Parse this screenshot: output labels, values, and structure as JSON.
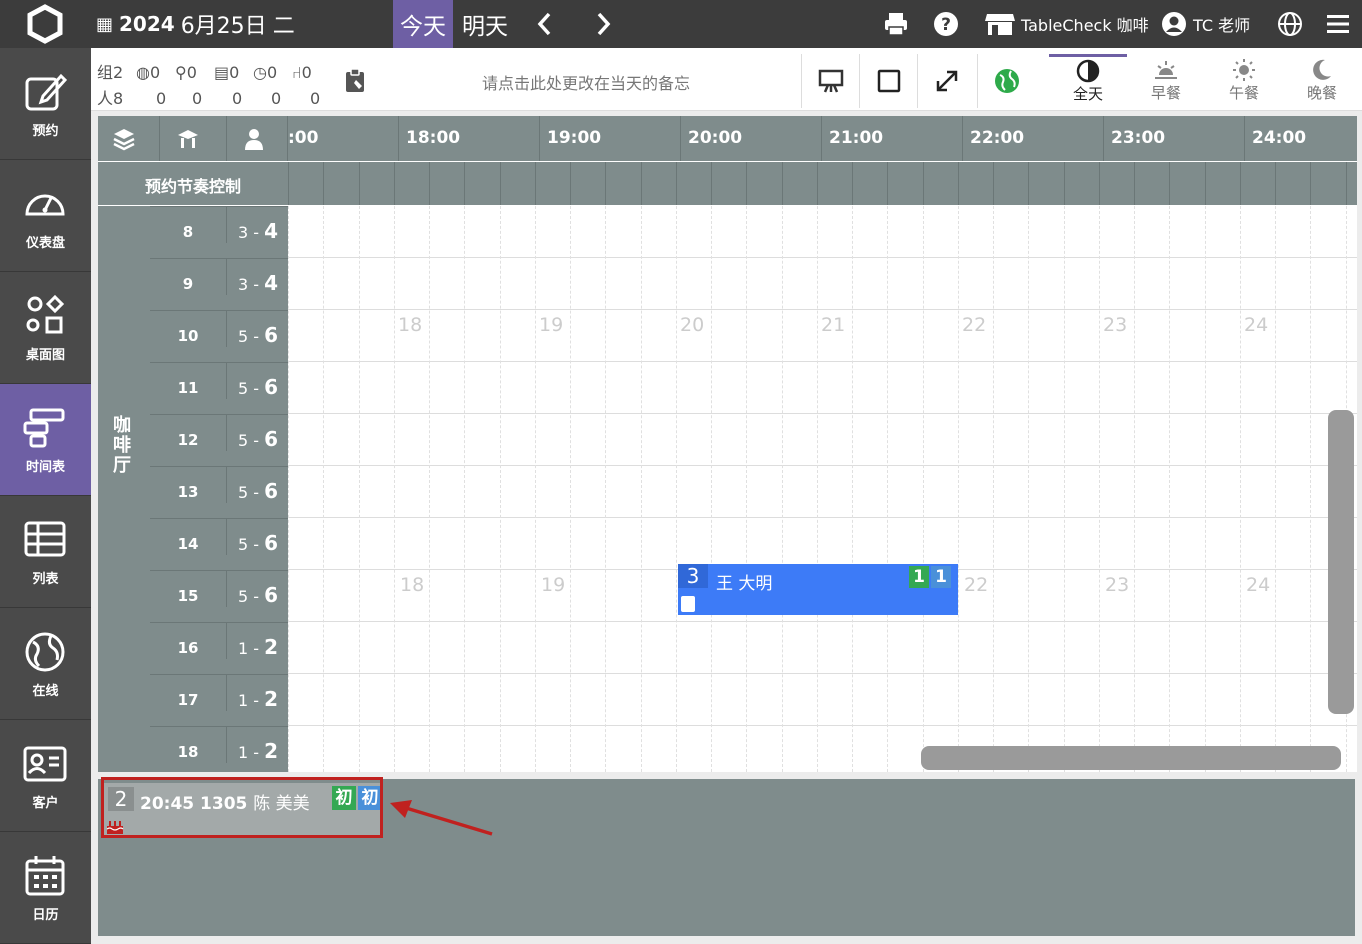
{
  "header": {
    "year": "2024",
    "date": "6月25日",
    "weekday": "二",
    "today": "今天",
    "tomorrow": "明天",
    "shop": "TableCheck 咖啡",
    "user": "TC 老师"
  },
  "sidebar": [
    {
      "label": "预约",
      "icon": "edit-icon"
    },
    {
      "label": "仪表盘",
      "icon": "gauge-icon"
    },
    {
      "label": "桌面图",
      "icon": "shapes-icon"
    },
    {
      "label": "时间表",
      "icon": "timeline-icon",
      "active": true
    },
    {
      "label": "列表",
      "icon": "table-icon"
    },
    {
      "label": "在线",
      "icon": "globe-icon"
    },
    {
      "label": "客户",
      "icon": "id-card-icon"
    },
    {
      "label": "日历",
      "icon": "calendar-icon"
    }
  ],
  "counts": {
    "row1": [
      "组2",
      "0",
      "0",
      "0",
      "0",
      "0"
    ],
    "row2": [
      "人8",
      "0",
      "0",
      "0",
      "0",
      "0"
    ]
  },
  "memo": "请点击此处更改在当天的备忘",
  "meal_tabs": [
    {
      "label": "全天",
      "active": true
    },
    {
      "label": "早餐"
    },
    {
      "label": "午餐"
    },
    {
      "label": "晚餐"
    }
  ],
  "timeline": {
    "time_labels": [
      ":00",
      "18:00",
      "19:00",
      "20:00",
      "21:00",
      "22:00",
      "23:00",
      "24:00"
    ],
    "rhythm_title": "预约节奏控制",
    "area": "咖啡厅",
    "tables": [
      {
        "no": "8",
        "min": "3",
        "max": "4"
      },
      {
        "no": "9",
        "min": "3",
        "max": "4"
      },
      {
        "no": "10",
        "min": "5",
        "max": "6"
      },
      {
        "no": "11",
        "min": "5",
        "max": "6"
      },
      {
        "no": "12",
        "min": "5",
        "max": "6"
      },
      {
        "no": "13",
        "min": "5",
        "max": "6"
      },
      {
        "no": "14",
        "min": "5",
        "max": "6"
      },
      {
        "no": "15",
        "min": "5",
        "max": "6"
      },
      {
        "no": "16",
        "min": "1",
        "max": "2"
      },
      {
        "no": "17",
        "min": "1",
        "max": "2"
      },
      {
        "no": "18",
        "min": "1",
        "max": "2"
      }
    ],
    "ghost_hours": [
      "18",
      "19",
      "20",
      "21",
      "22",
      "23",
      "24"
    ],
    "ghost_hours_row15": [
      "18",
      "19",
      "22",
      "23",
      "24"
    ],
    "reservation": {
      "pax": "3",
      "name": "王 大明",
      "badge1": "1",
      "badge2": "1"
    }
  },
  "waiting": {
    "pax": "2",
    "time_table": "20:45 1305",
    "name": "陈 美美",
    "tag1": "初",
    "tag2": "初"
  },
  "colors": {
    "accent": "#6e5fa4",
    "header_bg": "#3c3c3c",
    "grid_header": "#7f8c8c",
    "reservation": "#3d7bf7",
    "highlight": "#c0211f"
  }
}
